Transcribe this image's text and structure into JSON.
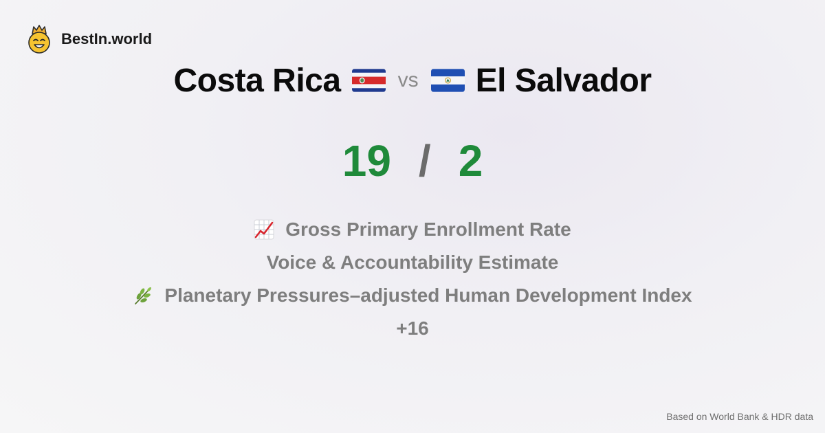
{
  "brand": {
    "name": "BestIn.world",
    "icon": "crowned-smiley-icon"
  },
  "title": {
    "left_country": "Costa Rica",
    "right_country": "El Salvador",
    "vs_label": "vs",
    "left_flag": "costa-rica-flag-icon",
    "right_flag": "el-salvador-flag-icon"
  },
  "score": {
    "left": "19",
    "separator": "/",
    "right": "2",
    "color": "#1f8a3a"
  },
  "metrics": [
    {
      "icon": "chart-increasing-icon",
      "label": "Gross Primary Enrollment Rate"
    },
    {
      "icon": "",
      "label": "Voice & Accountability Estimate"
    },
    {
      "icon": "herb-icon",
      "label": "Planetary Pressures–adjusted Human Development Index"
    },
    {
      "icon": "",
      "label": "+16"
    }
  ],
  "footer": {
    "note": "Based on World Bank & HDR data"
  }
}
